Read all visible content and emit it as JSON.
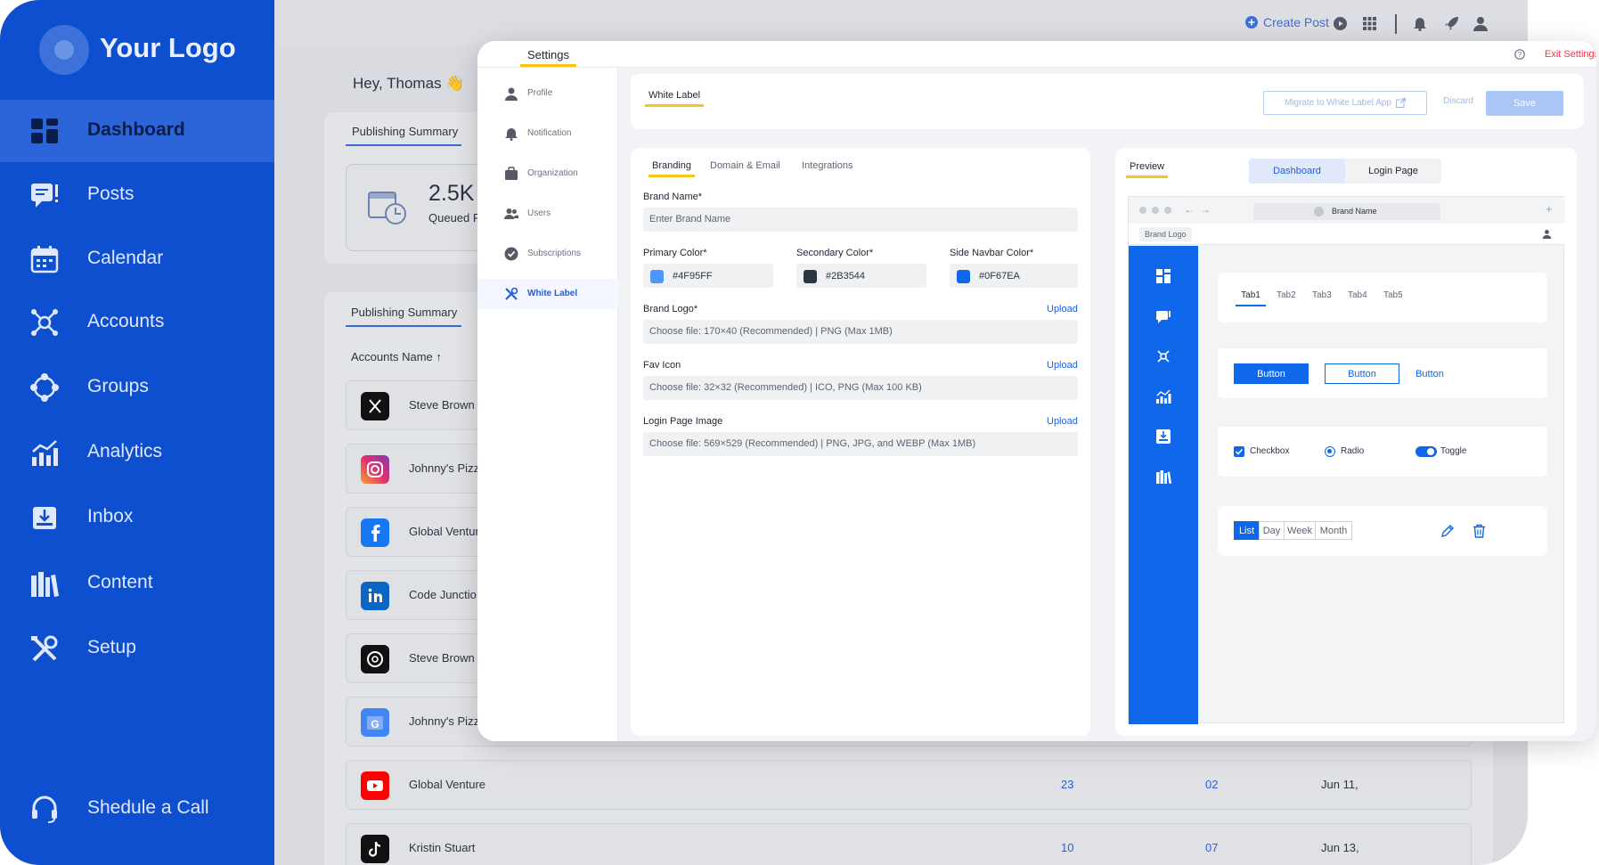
{
  "sidebar": {
    "logo_text": "Your Logo",
    "items": [
      {
        "label": "Dashboard"
      },
      {
        "label": "Posts"
      },
      {
        "label": "Calendar"
      },
      {
        "label": "Accounts"
      },
      {
        "label": "Groups"
      },
      {
        "label": "Analytics"
      },
      {
        "label": "Inbox"
      },
      {
        "label": "Content"
      },
      {
        "label": "Setup"
      }
    ],
    "schedule_call": "Shedule a Call"
  },
  "topbar": {
    "create_post": "Create Post"
  },
  "dashboard": {
    "greeting": "Hey, Thomas",
    "summary_tab": "Publishing Summary",
    "queued_value": "2.5K",
    "queued_label": "Queued P",
    "summary_tab_2": "Publishing Summary",
    "accounts_header": "Accounts Name",
    "accounts": [
      {
        "name": "Steve Brown",
        "platform": "x",
        "c1": "",
        "c2": "",
        "date": ""
      },
      {
        "name": "Johnny's Pizz",
        "platform": "instagram",
        "c1": "",
        "c2": "",
        "date": ""
      },
      {
        "name": "Global Ventur",
        "platform": "facebook",
        "c1": "",
        "c2": "",
        "date": ""
      },
      {
        "name": "Code Junctio",
        "platform": "linkedin",
        "c1": "",
        "c2": "",
        "date": ""
      },
      {
        "name": "Steve Brown",
        "platform": "threads",
        "c1": "",
        "c2": "",
        "date": ""
      },
      {
        "name": "Johnny's Pizz",
        "platform": "google-business",
        "c1": "",
        "c2": "",
        "date": ""
      },
      {
        "name": "Global Venture",
        "platform": "youtube",
        "c1": "23",
        "c2": "02",
        "date": "Jun 11,"
      },
      {
        "name": "Kristin Stuart",
        "platform": "tiktok",
        "c1": "10",
        "c2": "07",
        "date": "Jun 13,"
      }
    ]
  },
  "settings": {
    "title": "Settings",
    "exit": "Exit Settings",
    "menu": [
      {
        "label": "Profile"
      },
      {
        "label": "Notification"
      },
      {
        "label": "Organization"
      },
      {
        "label": "Users"
      },
      {
        "label": "Subscriptions"
      },
      {
        "label": "White Label"
      }
    ],
    "header_tab": "White Label",
    "migrate_btn": "Migrate to White Label App",
    "discard_btn": "Discard",
    "save_btn": "Save",
    "subtabs": [
      "Branding",
      "Domain & Email",
      "Integrations"
    ],
    "brand_name_label": "Brand Name*",
    "brand_name_placeholder": "Enter Brand Name",
    "primary_label": "Primary Color*",
    "primary_value": "#4F95FF",
    "secondary_label": "Secondary Color*",
    "secondary_value": "#2B3544",
    "sidenav_label": "Side Navbar Color*",
    "sidenav_value": "#0F67EA",
    "brand_logo_label": "Brand Logo*",
    "brand_logo_hint": "Choose file: 170×40 (Recommended) | PNG (Max 1MB)",
    "fav_icon_label": "Fav Icon",
    "fav_icon_hint": "Choose file: 32×32 (Recommended) | ICO, PNG (Max 100 KB)",
    "login_image_label": "Login Page Image",
    "login_image_hint": "Choose file: 569×529 (Recommended) | PNG, JPG, and WEBP (Max 1MB)",
    "upload": "Upload"
  },
  "preview": {
    "tab": "Preview",
    "toggle": [
      "Dashboard",
      "Login Page"
    ],
    "url_text": "Brand Name",
    "brand_logo": "Brand Logo",
    "tabs": [
      "Tab1",
      "Tab2",
      "Tab3",
      "Tab4",
      "Tab5"
    ],
    "buttons": [
      "Button",
      "Button",
      "Button"
    ],
    "checkbox": "Checkbox",
    "radio": "Radio",
    "toggle_label": "Toggle",
    "segments": [
      "List",
      "Day",
      "Week",
      "Month"
    ]
  },
  "colors": {
    "sidebar_bg": "#0E4FD0",
    "primary": "#4F95FF",
    "secondary": "#2B3544",
    "side_navbar": "#0F67EA",
    "accent": "#1F5FE0",
    "highlight": "#F5C518"
  }
}
